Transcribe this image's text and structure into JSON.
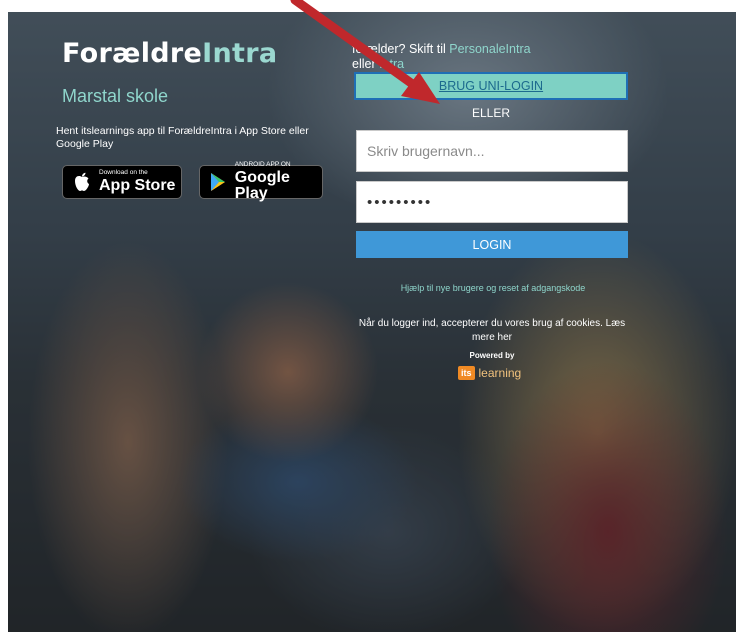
{
  "brand": {
    "part1": "Forældre",
    "part2": "Intra"
  },
  "school": "Marstal skole",
  "app_promo": "Hent itslearnings app til ForældreIntra i App Store eller Google Play",
  "stores": {
    "appstore": {
      "small": "Download on the",
      "big": "App Store"
    },
    "googleplay": {
      "small": "ANDROID APP ON",
      "big": "Google Play"
    }
  },
  "prompt": {
    "text1": "    forælder? Skift til ",
    "link1": "PersonaleIntra",
    "text2": " eller ",
    "link2": "  Intra"
  },
  "uni_login_label": "BRUG UNI-LOGIN",
  "or_label": "ELLER",
  "username": {
    "placeholder": "Skriv brugernavn...",
    "value": ""
  },
  "password": {
    "value": "•••••••••"
  },
  "login_label": "LOGIN",
  "help_link": "Hjælp til nye brugere og reset af adgangskode",
  "cookies_text": "Når du logger ind, accepterer du vores brug af cookies. Læs mere her",
  "powered_by": "Powered by",
  "itslearning": {
    "badge": "its",
    "word": "learning"
  },
  "colors": {
    "accent": "#8fd6cc",
    "uni_button": "#7ed1c4",
    "login_button": "#3f98d8",
    "arrow": "#c0282c"
  },
  "icons": {
    "apple": "apple-icon",
    "play": "google-play-icon",
    "arrow": "red-arrow"
  }
}
